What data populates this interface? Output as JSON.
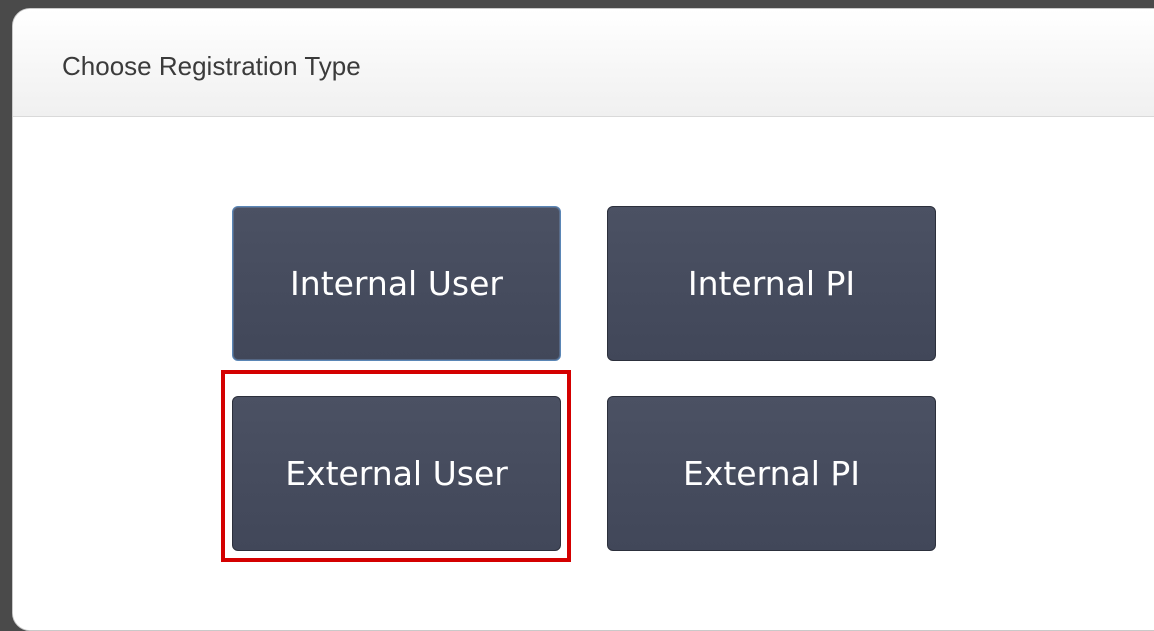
{
  "dialog": {
    "title": "Choose Registration Type"
  },
  "buttons": {
    "internal_user": "Internal User",
    "internal_pi": "Internal PI",
    "external_user": "External User",
    "external_pi": "External PI"
  },
  "colors": {
    "button_bg": "#454b5d",
    "highlight": "#d40000",
    "backdrop": "#4a4a4a"
  }
}
